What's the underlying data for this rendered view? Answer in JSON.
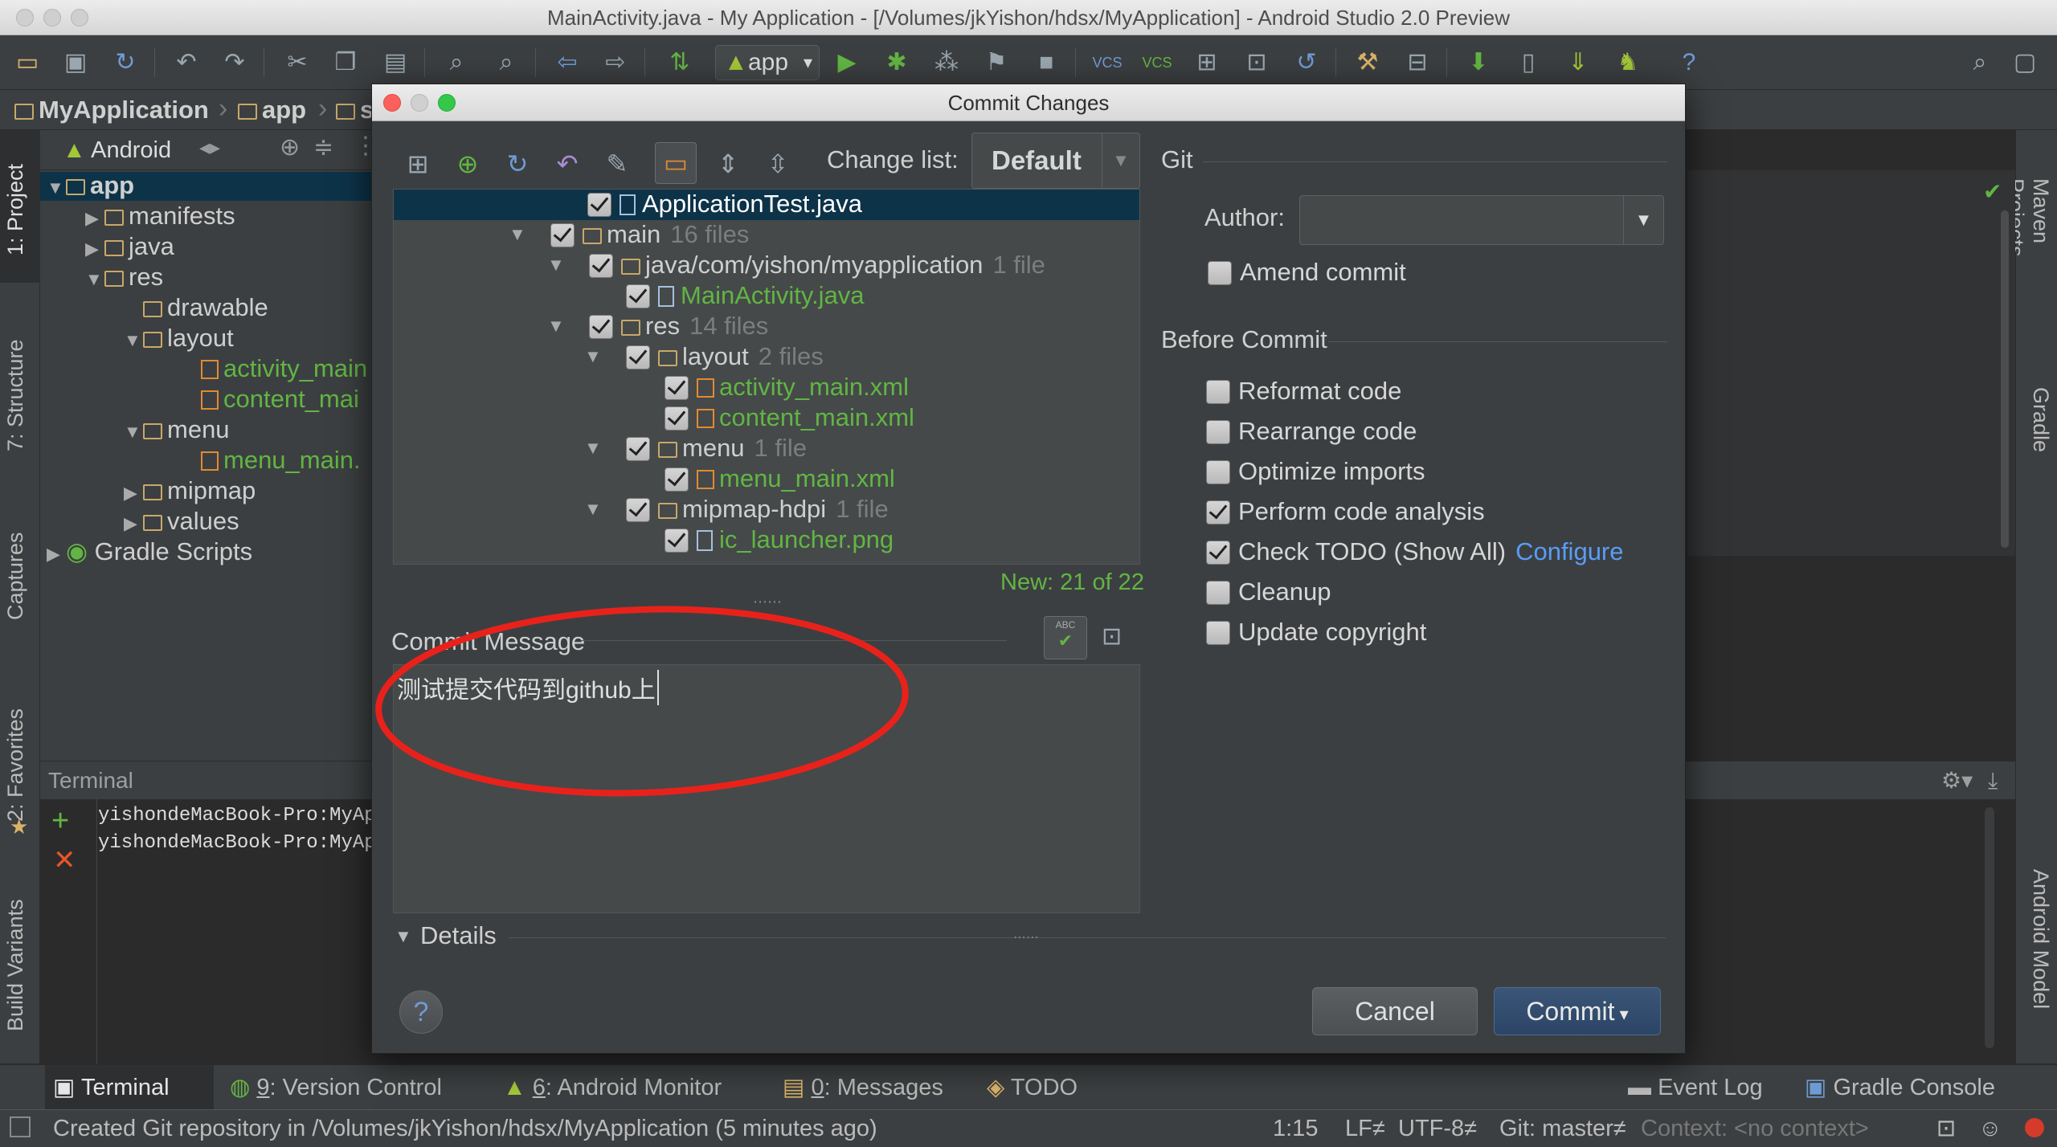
{
  "window": {
    "title": "MainActivity.java - My Application - [/Volumes/jkYishon/hdsx/MyApplication] - Android Studio 2.0 Preview"
  },
  "toolbar": {
    "run_config": "app"
  },
  "navbar": {
    "crumbs": [
      "MyApplication",
      "app",
      "s"
    ]
  },
  "left_strip": {
    "tabs": [
      "1: Project",
      "7: Structure",
      "Captures",
      "2: Favorites",
      "Build Variants"
    ]
  },
  "right_strip": {
    "tabs": [
      "Maven Projects",
      "Gradle",
      "Android Model"
    ]
  },
  "project_panel": {
    "view": "Android",
    "tree": [
      {
        "label": "app",
        "level": 0
      },
      {
        "label": "manifests",
        "level": 1
      },
      {
        "label": "java",
        "level": 1
      },
      {
        "label": "res",
        "level": 1
      },
      {
        "label": "drawable",
        "level": 2
      },
      {
        "label": "layout",
        "level": 2
      },
      {
        "label": "activity_main",
        "level": 3
      },
      {
        "label": "content_mai",
        "level": 3
      },
      {
        "label": "menu",
        "level": 2
      },
      {
        "label": "menu_main.",
        "level": 3
      },
      {
        "label": "mipmap",
        "level": 2
      },
      {
        "label": "values",
        "level": 2
      },
      {
        "label": "Gradle Scripts",
        "level": 0
      }
    ]
  },
  "terminal": {
    "title": "Terminal",
    "lines": [
      "yishondeMacBook-Pro:MyApp",
      "yishondeMacBook-Pro:MyApp"
    ]
  },
  "bottom_tabs": [
    {
      "num": "",
      "label": "Terminal"
    },
    {
      "num": "9",
      "label": ": Version Control"
    },
    {
      "num": "6",
      "label": ": Android Monitor"
    },
    {
      "num": "0",
      "label": ": Messages"
    },
    {
      "num": "",
      "label": "TODO"
    },
    {
      "num": "",
      "label": "Event Log"
    },
    {
      "num": "",
      "label": "Gradle Console"
    }
  ],
  "status_bar": {
    "message": "Created Git repository in /Volumes/jkYishon/hdsx/MyApplication (5 minutes ago)",
    "position": "1:15",
    "line_sep": "LF≠",
    "encoding": "UTF-8≠",
    "vcs": "Git: master≠",
    "context": "Context: <no context>"
  },
  "dialog": {
    "title": "Commit Changes",
    "change_list_label": "Change list:",
    "change_list_value": "Default",
    "files": [
      {
        "name": "ApplicationTest.java",
        "count": "",
        "kind": "java",
        "level": 5,
        "selected": true,
        "green": false
      },
      {
        "name": "main",
        "count": "16 files",
        "kind": "folder",
        "level": 3,
        "selected": false,
        "green": false
      },
      {
        "name": "java/com/yishon/myapplication",
        "count": "1 file",
        "kind": "folder",
        "level": 4,
        "selected": false,
        "green": false
      },
      {
        "name": "MainActivity.java",
        "count": "",
        "kind": "java",
        "level": 5,
        "selected": false,
        "green": true
      },
      {
        "name": "res",
        "count": "14 files",
        "kind": "folder",
        "level": 4,
        "selected": false,
        "green": false
      },
      {
        "name": "layout",
        "count": "2 files",
        "kind": "folder",
        "level": 5,
        "selected": false,
        "green": false
      },
      {
        "name": "activity_main.xml",
        "count": "",
        "kind": "xml",
        "level": 6,
        "selected": false,
        "green": true
      },
      {
        "name": "content_main.xml",
        "count": "",
        "kind": "xml",
        "level": 6,
        "selected": false,
        "green": true
      },
      {
        "name": "menu",
        "count": "1 file",
        "kind": "folder",
        "level": 5,
        "selected": false,
        "green": false
      },
      {
        "name": "menu_main.xml",
        "count": "",
        "kind": "xml",
        "level": 6,
        "selected": false,
        "green": true
      },
      {
        "name": "mipmap-hdpi",
        "count": "1 file",
        "kind": "folder",
        "level": 5,
        "selected": false,
        "green": false
      },
      {
        "name": "ic_launcher.png",
        "count": "",
        "kind": "png",
        "level": 6,
        "selected": false,
        "green": true
      }
    ],
    "new_count": "New: 21 of 22",
    "commit_message_label": "Commit Message",
    "commit_message": "测试提交代码到github上",
    "details_label": "Details",
    "git_section": "Git",
    "author_label": "Author:",
    "author_value": "",
    "amend_label": "Amend commit",
    "before_commit_label": "Before Commit",
    "options": [
      {
        "label": "Reformat code",
        "checked": false,
        "link": ""
      },
      {
        "label": "Rearrange code",
        "checked": false,
        "link": ""
      },
      {
        "label": "Optimize imports",
        "checked": false,
        "link": ""
      },
      {
        "label": "Perform code analysis",
        "checked": true,
        "link": ""
      },
      {
        "label": "Check TODO (Show All)",
        "checked": true,
        "link": "Configure"
      },
      {
        "label": "Cleanup",
        "checked": false,
        "link": ""
      },
      {
        "label": "Update copyright",
        "checked": false,
        "link": ""
      }
    ],
    "cancel_label": "Cancel",
    "commit_label": "Commit",
    "help_label": "?"
  },
  "colors": {
    "annotation": "#e8221b",
    "link": "#589df6",
    "accent_green": "#62b543"
  }
}
